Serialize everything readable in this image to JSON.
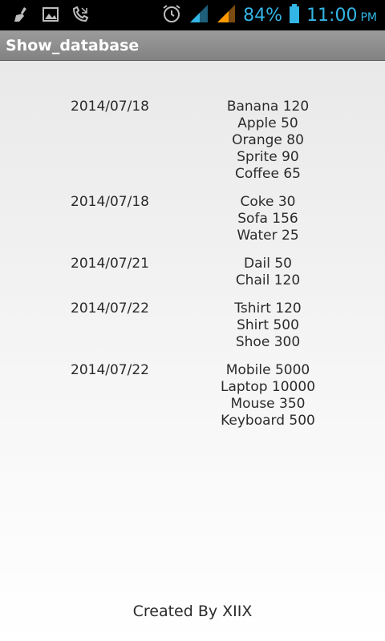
{
  "status_bar": {
    "battery_percent": "84%",
    "time": "11:00",
    "ampm": "PM",
    "accent_color": "#33b5e5",
    "icons": [
      "cleaner-icon",
      "image-icon",
      "missed-call-icon",
      "alarm-icon",
      "signal-icon",
      "signal-icon",
      "battery-icon"
    ]
  },
  "action_bar": {
    "title": "Show_database"
  },
  "records": [
    {
      "date": "2014/07/18",
      "items": [
        "Banana 120",
        "Apple 50",
        "Orange 80",
        "Sprite 90",
        "Coffee 65"
      ]
    },
    {
      "date": "2014/07/18",
      "items": [
        "Coke 30",
        "Sofa 156",
        "Water 25"
      ]
    },
    {
      "date": "2014/07/21",
      "items": [
        "Dail 50",
        "Chail 120"
      ]
    },
    {
      "date": "2014/07/22",
      "items": [
        "Tshirt 120",
        "Shirt 500",
        "Shoe 300"
      ]
    },
    {
      "date": "2014/07/22",
      "items": [
        "Mobile 5000",
        "Laptop 10000",
        "Mouse 350",
        "Keyboard 500"
      ]
    }
  ],
  "footer": {
    "text": "Created By XIIX"
  }
}
